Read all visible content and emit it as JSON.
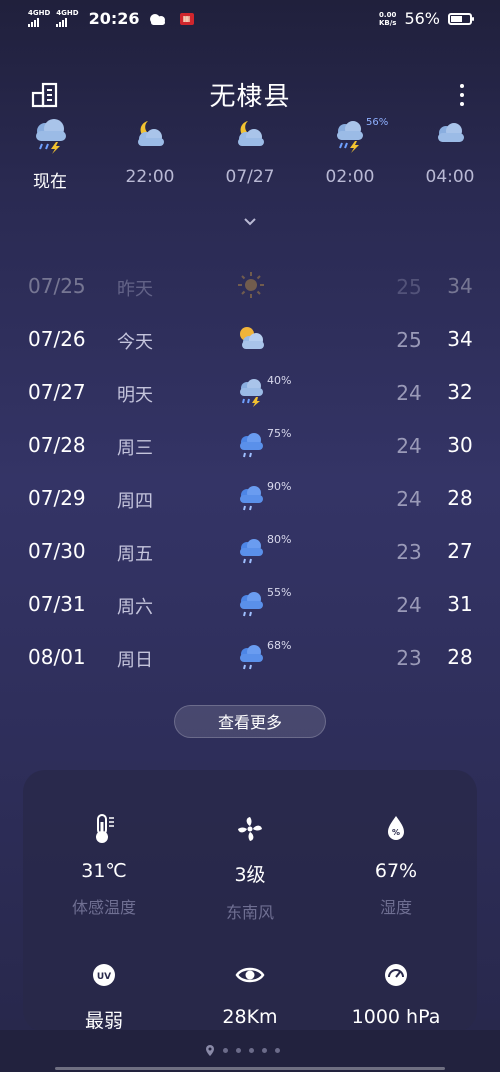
{
  "status_bar": {
    "network_1": "4GHD",
    "network_2": "4GHD",
    "time": "20:26",
    "speed_value": "0.00",
    "speed_unit": "KB/s",
    "battery": "56%"
  },
  "header": {
    "city": "无棣县"
  },
  "hourly": [
    {
      "label": "现在",
      "icon": "thunderstorm-icon",
      "precip": ""
    },
    {
      "label": "22:00",
      "icon": "moon-cloud-icon",
      "precip": ""
    },
    {
      "label": "07/27",
      "icon": "moon-cloud-icon",
      "precip": ""
    },
    {
      "label": "02:00",
      "icon": "thunderstorm-icon",
      "precip": "56%"
    },
    {
      "label": "04:00",
      "icon": "cloud-icon",
      "precip": ""
    }
  ],
  "daily": [
    {
      "date": "07/25",
      "day": "昨天",
      "icon": "sun-icon",
      "precip": "",
      "low": "25",
      "high": "34"
    },
    {
      "date": "07/26",
      "day": "今天",
      "icon": "partly-cloudy-icon",
      "precip": "",
      "low": "25",
      "high": "34"
    },
    {
      "date": "07/27",
      "day": "明天",
      "icon": "thunderstorm-icon",
      "precip": "40%",
      "low": "24",
      "high": "32"
    },
    {
      "date": "07/28",
      "day": "周三",
      "icon": "rain-icon",
      "precip": "75%",
      "low": "24",
      "high": "30"
    },
    {
      "date": "07/29",
      "day": "周四",
      "icon": "rain-icon",
      "precip": "90%",
      "low": "24",
      "high": "28"
    },
    {
      "date": "07/30",
      "day": "周五",
      "icon": "rain-icon",
      "precip": "80%",
      "low": "23",
      "high": "27"
    },
    {
      "date": "07/31",
      "day": "周六",
      "icon": "rain-icon",
      "precip": "55%",
      "low": "24",
      "high": "31"
    },
    {
      "date": "08/01",
      "day": "周日",
      "icon": "rain-icon",
      "precip": "68%",
      "low": "23",
      "high": "28"
    }
  ],
  "more_button": "查看更多",
  "details": [
    {
      "icon": "thermometer-icon",
      "value": "31℃",
      "caption": "体感温度"
    },
    {
      "icon": "fan-icon",
      "value": "3级",
      "caption": "东南风"
    },
    {
      "icon": "humidity-drop-icon",
      "value": "67%",
      "caption": "湿度"
    },
    {
      "icon": "uv-icon",
      "value": "最弱",
      "caption": ""
    },
    {
      "icon": "eye-icon",
      "value": "28Km",
      "caption": ""
    },
    {
      "icon": "gauge-icon",
      "value": "1000 hPa",
      "caption": ""
    }
  ],
  "colors": {
    "precip_accent": "#8fb0ff",
    "sun": "#f0b43a",
    "rain_cloud": "#4d86e6"
  }
}
